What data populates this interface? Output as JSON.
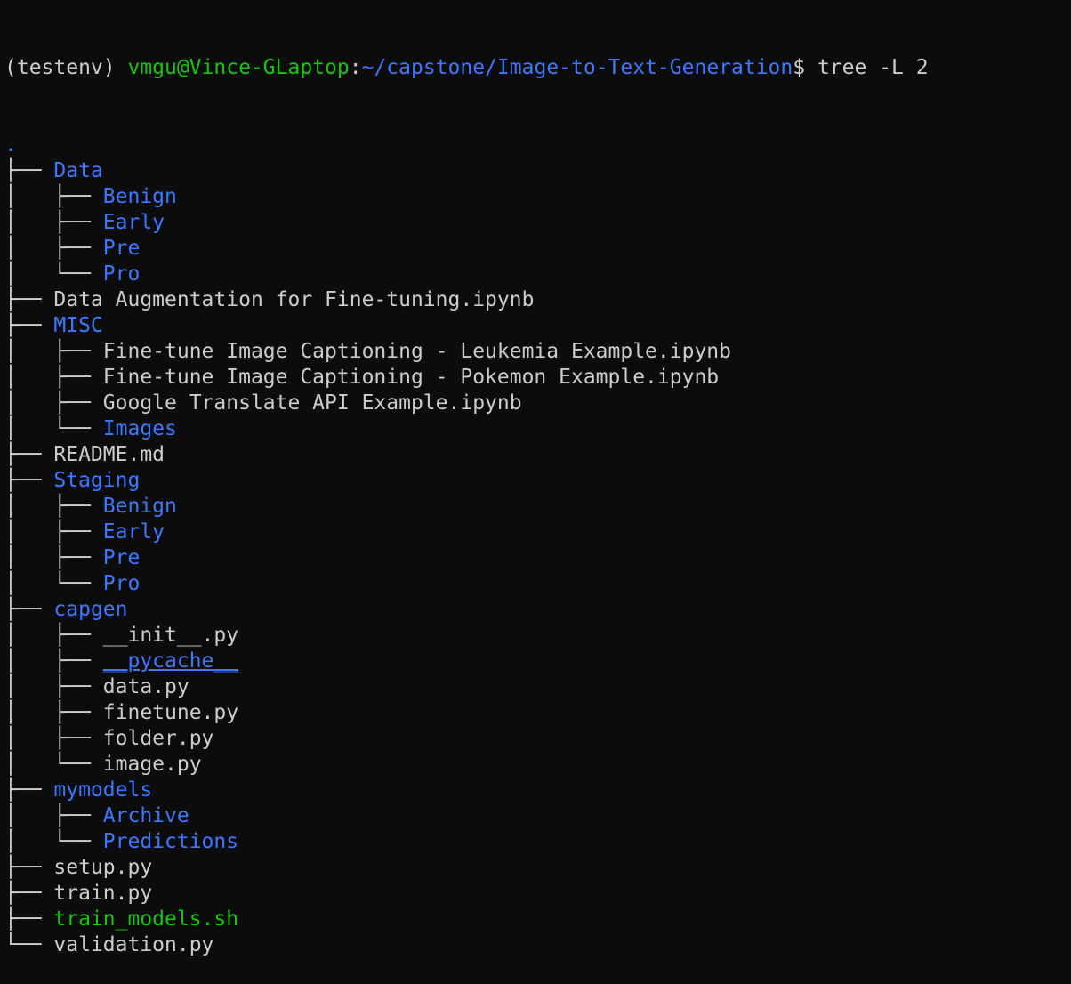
{
  "prompt": {
    "env": "(testenv) ",
    "user_host": "vmgu@Vince-GLaptop",
    "colon": ":",
    "path": "~/capstone/Image-to-Text-Generation",
    "symbol": "$ ",
    "command": "tree -L 2"
  },
  "tree": [
    {
      "prefix": "",
      "name": ".",
      "kind": "dir"
    },
    {
      "prefix": "├── ",
      "name": "Data",
      "kind": "dir"
    },
    {
      "prefix": "│   ├── ",
      "name": "Benign",
      "kind": "dir"
    },
    {
      "prefix": "│   ├── ",
      "name": "Early",
      "kind": "dir"
    },
    {
      "prefix": "│   ├── ",
      "name": "Pre",
      "kind": "dir"
    },
    {
      "prefix": "│   └── ",
      "name": "Pro",
      "kind": "dir"
    },
    {
      "prefix": "├── ",
      "name": "Data Augmentation for Fine-tuning.ipynb",
      "kind": "file"
    },
    {
      "prefix": "├── ",
      "name": "MISC",
      "kind": "dir"
    },
    {
      "prefix": "│   ├── ",
      "name": "Fine-tune Image Captioning - Leukemia Example.ipynb",
      "kind": "file"
    },
    {
      "prefix": "│   ├── ",
      "name": "Fine-tune Image Captioning - Pokemon Example.ipynb",
      "kind": "file"
    },
    {
      "prefix": "│   ├── ",
      "name": "Google Translate API Example.ipynb",
      "kind": "file"
    },
    {
      "prefix": "│   └── ",
      "name": "Images",
      "kind": "dir"
    },
    {
      "prefix": "├── ",
      "name": "README.md",
      "kind": "file"
    },
    {
      "prefix": "├── ",
      "name": "Staging",
      "kind": "dir"
    },
    {
      "prefix": "│   ├── ",
      "name": "Benign",
      "kind": "dir"
    },
    {
      "prefix": "│   ├── ",
      "name": "Early",
      "kind": "dir"
    },
    {
      "prefix": "│   ├── ",
      "name": "Pre",
      "kind": "dir"
    },
    {
      "prefix": "│   └── ",
      "name": "Pro",
      "kind": "dir"
    },
    {
      "prefix": "├── ",
      "name": "capgen",
      "kind": "dir"
    },
    {
      "prefix": "│   ├── ",
      "name": "__init__.py",
      "kind": "file"
    },
    {
      "prefix": "│   ├── ",
      "name": "__pycache__",
      "kind": "dir-underline"
    },
    {
      "prefix": "│   ├── ",
      "name": "data.py",
      "kind": "file"
    },
    {
      "prefix": "│   ├── ",
      "name": "finetune.py",
      "kind": "file"
    },
    {
      "prefix": "│   ├── ",
      "name": "folder.py",
      "kind": "file"
    },
    {
      "prefix": "│   └── ",
      "name": "image.py",
      "kind": "file"
    },
    {
      "prefix": "├── ",
      "name": "mymodels",
      "kind": "dir"
    },
    {
      "prefix": "│   ├── ",
      "name": "Archive",
      "kind": "dir"
    },
    {
      "prefix": "│   └── ",
      "name": "Predictions",
      "kind": "dir"
    },
    {
      "prefix": "├── ",
      "name": "setup.py",
      "kind": "file"
    },
    {
      "prefix": "├── ",
      "name": "train.py",
      "kind": "file"
    },
    {
      "prefix": "├── ",
      "name": "train_models.sh",
      "kind": "exec"
    },
    {
      "prefix": "└── ",
      "name": "validation.py",
      "kind": "file"
    }
  ],
  "colors": {
    "background": "#0c0c0c",
    "foreground": "#cccccc",
    "directory": "#3b78ff",
    "executable": "#16c60c",
    "prompt_user": "#16c60c",
    "prompt_path": "#3b78ff"
  }
}
